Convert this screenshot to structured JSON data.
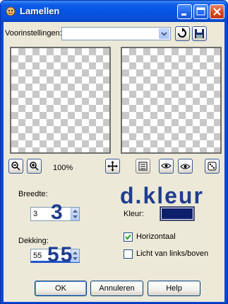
{
  "window": {
    "title": "Lamellen"
  },
  "presets": {
    "label": "Voorinstellingen:",
    "value": ""
  },
  "zoom": {
    "level": "100%"
  },
  "breedte": {
    "label": "Breedte:",
    "value": "3"
  },
  "dekking": {
    "label": "Dekking:",
    "value": "55"
  },
  "annotations": {
    "big_breedte": "3",
    "big_dekking": "55",
    "header": "d.kleur"
  },
  "kleur": {
    "label": "Kleur:",
    "color": "#0c1f6b"
  },
  "horizontaal": {
    "label": "Horizontaal",
    "checked": true
  },
  "licht": {
    "label": "Licht van links/boven",
    "checked": false
  },
  "buttons": {
    "ok": "OK",
    "cancel": "Annuleren",
    "help": "Help"
  }
}
